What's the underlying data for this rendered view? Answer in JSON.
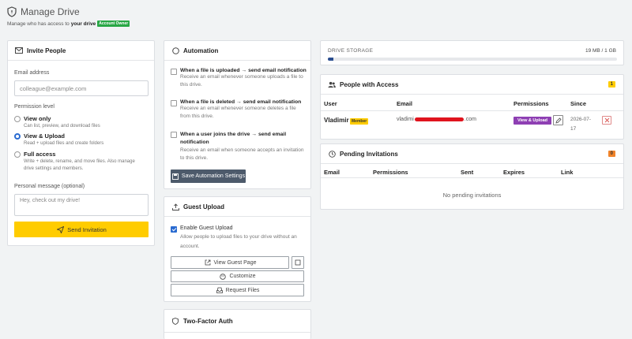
{
  "header": {
    "title": "Manage Drive",
    "subtitle_prefix": "Manage who has access to",
    "subtitle_bold": "your drive",
    "owner_badge": "Account Owner"
  },
  "invite": {
    "title": "Invite People",
    "email_label": "Email address",
    "email_placeholder": "colleague@example.com",
    "permission_label": "Permission level",
    "options": [
      {
        "title": "View only",
        "desc": "Can list, preview, and download files",
        "selected": false
      },
      {
        "title": "View & Upload",
        "desc": "Read + upload files and create folders",
        "selected": true
      },
      {
        "title": "Full access",
        "desc": "Write + delete, rename, and move files. Also manage drive settings and members.",
        "selected": false
      }
    ],
    "message_label": "Personal message (optional)",
    "message_placeholder": "Hey, check out my drive!",
    "send_label": "Send Invitation"
  },
  "automation": {
    "title": "Automation",
    "rules": [
      {
        "title": "When a file is uploaded → send email notification",
        "desc": "Receive an email whenever someone uploads a file to this drive."
      },
      {
        "title": "When a file is deleted → send email notification",
        "desc": "Receive an email whenever someone deletes a file from this drive."
      },
      {
        "title": "When a user joins the drive → send email notification",
        "desc": "Receive an email when someone accepts an invitation to this drive."
      }
    ],
    "save_label": "Save Automation Settings"
  },
  "guest": {
    "title": "Guest Upload",
    "enable_label": "Enable Guest Upload",
    "enable_desc": "Allow people to upload files to your drive without an account.",
    "view_page_label": "View Guest Page",
    "customize_label": "Customize",
    "request_label": "Request Files"
  },
  "twofa": {
    "title": "Two-Factor Auth"
  },
  "storage": {
    "label": "DRIVE STORAGE",
    "usage": "19 MB / 1 GB",
    "fill_fraction": 0.019
  },
  "access": {
    "title": "People with Access",
    "count": "1",
    "columns": [
      "User",
      "Email",
      "Permissions",
      "Since"
    ],
    "rows": [
      {
        "user": "Vladimir",
        "role": "Member",
        "email_start": "vladimi",
        "email_end": ".com",
        "permission": "View & Upload",
        "since_line1": "2026-07-",
        "since_line2": "17"
      }
    ]
  },
  "pending": {
    "title": "Pending Invitations",
    "count": "0",
    "columns": [
      "Email",
      "Permissions",
      "Sent",
      "Expires",
      "Link"
    ],
    "empty_text": "No pending invitations"
  },
  "colors": {
    "accent_yellow": "#ffcc00",
    "green_badge": "#28a745",
    "purple": "#8e3fb3",
    "orange": "#f0832a",
    "dark_button": "#4d5a6b"
  }
}
